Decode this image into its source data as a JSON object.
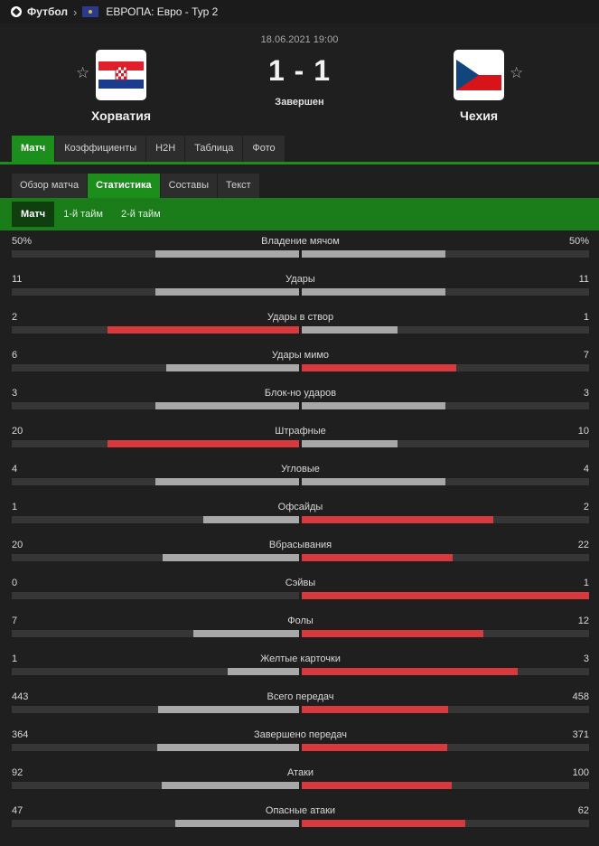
{
  "breadcrumb": {
    "sport": "Футбол",
    "competition": "ЕВРОПА: Евро - Тур 2"
  },
  "match": {
    "date": "18.06.2021 19:00",
    "score": "1 - 1",
    "status": "Завершен",
    "home": {
      "name": "Хорватия"
    },
    "away": {
      "name": "Чехия"
    }
  },
  "tabs_main": [
    "Матч",
    "Коэффициенты",
    "H2H",
    "Таблица",
    "Фото"
  ],
  "tabs_sub": [
    "Обзор матча",
    "Статистика",
    "Составы",
    "Текст"
  ],
  "tabs_period": [
    "Матч",
    "1-й тайм",
    "2-й тайм"
  ],
  "stats": [
    {
      "label": "Владение мячом",
      "home": "50%",
      "away": "50%",
      "h": 50,
      "a": 50
    },
    {
      "label": "Удары",
      "home": "11",
      "away": "11",
      "h": 11,
      "a": 11
    },
    {
      "label": "Удары в створ",
      "home": "2",
      "away": "1",
      "h": 2,
      "a": 1
    },
    {
      "label": "Удары мимо",
      "home": "6",
      "away": "7",
      "h": 6,
      "a": 7
    },
    {
      "label": "Блок-но ударов",
      "home": "3",
      "away": "3",
      "h": 3,
      "a": 3
    },
    {
      "label": "Штрафные",
      "home": "20",
      "away": "10",
      "h": 20,
      "a": 10
    },
    {
      "label": "Угловые",
      "home": "4",
      "away": "4",
      "h": 4,
      "a": 4
    },
    {
      "label": "Офсайды",
      "home": "1",
      "away": "2",
      "h": 1,
      "a": 2
    },
    {
      "label": "Вбрасывания",
      "home": "20",
      "away": "22",
      "h": 20,
      "a": 22
    },
    {
      "label": "Сэйвы",
      "home": "0",
      "away": "1",
      "h": 0,
      "a": 1
    },
    {
      "label": "Фолы",
      "home": "7",
      "away": "12",
      "h": 7,
      "a": 12
    },
    {
      "label": "Желтые карточки",
      "home": "1",
      "away": "3",
      "h": 1,
      "a": 3
    },
    {
      "label": "Всего передач",
      "home": "443",
      "away": "458",
      "h": 443,
      "a": 458
    },
    {
      "label": "Завершено передач",
      "home": "364",
      "away": "371",
      "h": 364,
      "a": 371
    },
    {
      "label": "Атаки",
      "home": "92",
      "away": "100",
      "h": 92,
      "a": 100
    },
    {
      "label": "Опасные атаки",
      "home": "47",
      "away": "62",
      "h": 47,
      "a": 62
    }
  ],
  "colors": {
    "accent": "#1b8e1b",
    "leader_bar": "#d7393d",
    "other_bar": "#a8a8a8"
  }
}
